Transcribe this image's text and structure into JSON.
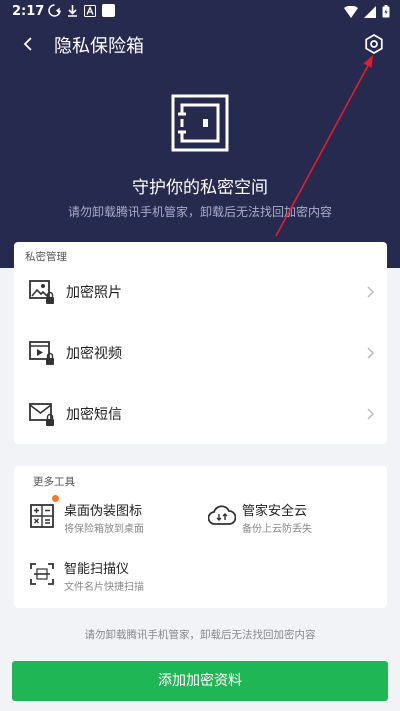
{
  "status": {
    "time": "2:17"
  },
  "header": {
    "title": "隐私保险箱",
    "hero_title": "守护你的私密空间",
    "hero_subtitle": "请勿卸载腾讯手机管家，卸载后无法找回加密内容"
  },
  "private": {
    "heading": "私密管理",
    "items": [
      {
        "label": "加密照片",
        "icon": "photo-lock-icon"
      },
      {
        "label": "加密视频",
        "icon": "video-lock-icon"
      },
      {
        "label": "加密短信",
        "icon": "message-lock-icon"
      }
    ]
  },
  "tools": {
    "heading": "更多工具",
    "items": [
      {
        "title": "桌面伪装图标",
        "subtitle": "将保险箱放到桌面",
        "icon": "calculator-icon",
        "badge": true
      },
      {
        "title": "管家安全云",
        "subtitle": "备份上云防丢失",
        "icon": "cloud-sync-icon",
        "badge": false
      },
      {
        "title": "智能扫描仪",
        "subtitle": "文件名片快捷扫描",
        "icon": "scanner-icon",
        "badge": false
      }
    ]
  },
  "footnote": "请勿卸载腾讯手机管家，卸载后无法找回加密内容",
  "add_button": "添加加密资料",
  "colors": {
    "header_bg": "#262a4f",
    "primary": "#1fb655",
    "badge": "#f07c2a",
    "annotation_arrow": "#e8192c"
  }
}
